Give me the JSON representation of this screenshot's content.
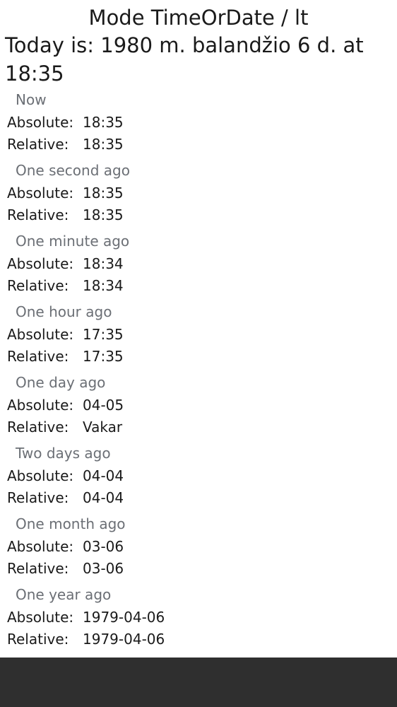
{
  "title": "Mode TimeOrDate / lt",
  "today": "Today is: 1980 m. balandžio 6 d. at 18:35",
  "labels": {
    "absolute": "Absolute:",
    "relative": "Relative:"
  },
  "sections": [
    {
      "header": "Now",
      "absolute": "18:35",
      "relative": "18:35"
    },
    {
      "header": "One second ago",
      "absolute": "18:35",
      "relative": "18:35"
    },
    {
      "header": "One minute ago",
      "absolute": "18:34",
      "relative": "18:34"
    },
    {
      "header": "One hour ago",
      "absolute": "17:35",
      "relative": "17:35"
    },
    {
      "header": "One day ago",
      "absolute": "04-05",
      "relative": "Vakar"
    },
    {
      "header": "Two days ago",
      "absolute": "04-04",
      "relative": "04-04"
    },
    {
      "header": "One month ago",
      "absolute": "03-06",
      "relative": "03-06"
    },
    {
      "header": "One year ago",
      "absolute": "1979-04-06",
      "relative": "1979-04-06"
    }
  ]
}
